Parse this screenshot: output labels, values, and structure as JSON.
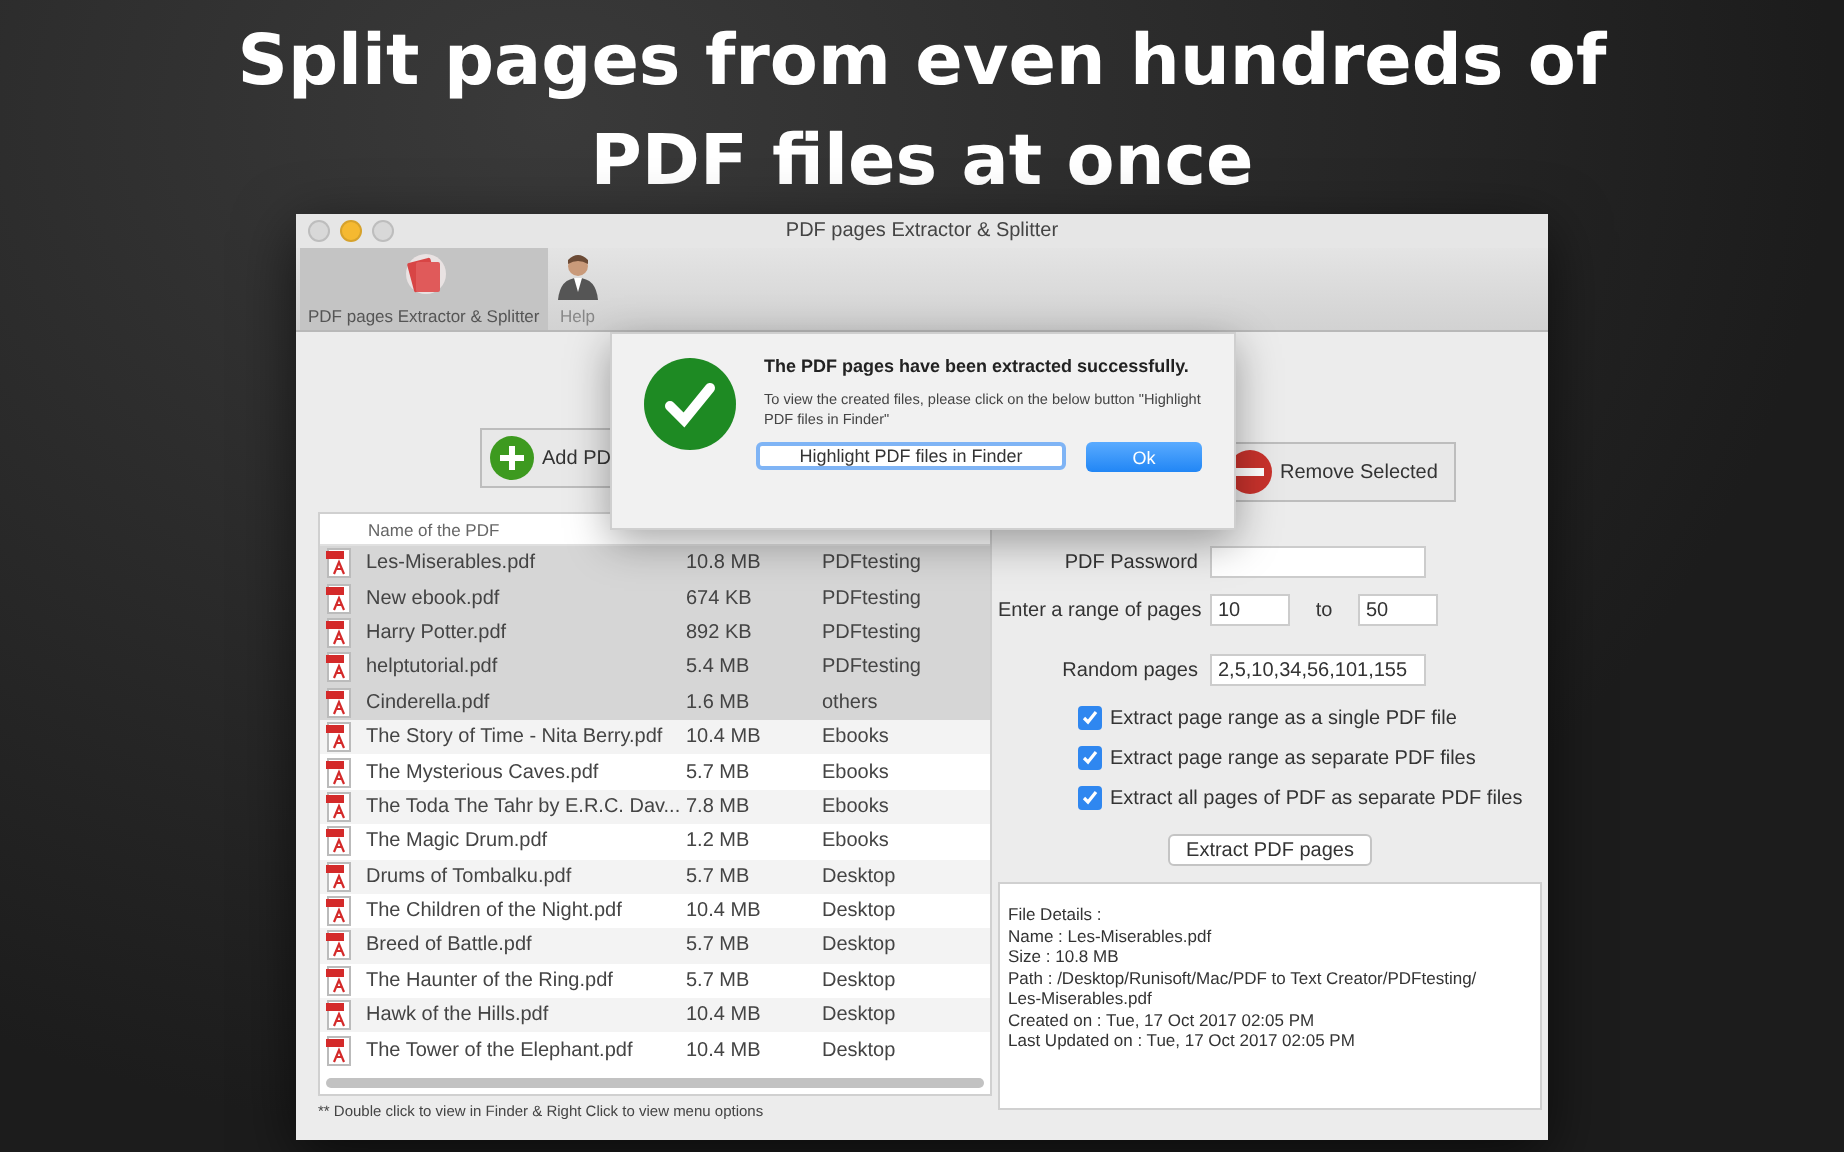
{
  "headline": "Split pages from even hundreds of PDF files at once",
  "window": {
    "title": "PDF pages Extractor & Splitter"
  },
  "toolbar": [
    {
      "label": "PDF pages Extractor & Splitter",
      "selected": true,
      "kind": "pdf"
    },
    {
      "label": "Help",
      "selected": false,
      "kind": "help"
    }
  ],
  "add_button": "Add PD",
  "remove_button": "Remove Selected",
  "table": {
    "columns": [
      "Name of the PDF"
    ],
    "rows": [
      {
        "name": "Les-Miserables.pdf",
        "size": "10.8 MB",
        "folder": "PDFtesting",
        "selected": true
      },
      {
        "name": "New ebook.pdf",
        "size": "674 KB",
        "folder": "PDFtesting",
        "selected": true
      },
      {
        "name": "Harry Potter.pdf",
        "size": "892 KB",
        "folder": "PDFtesting",
        "selected": true
      },
      {
        "name": "helptutorial.pdf",
        "size": "5.4 MB",
        "folder": "PDFtesting",
        "selected": true
      },
      {
        "name": "Cinderella.pdf",
        "size": "1.6 MB",
        "folder": "others",
        "selected": true
      },
      {
        "name": "The Story of Time - Nita Berry.pdf",
        "size": "10.4 MB",
        "folder": "Ebooks",
        "selected": false
      },
      {
        "name": "The Mysterious Caves.pdf",
        "size": "5.7 MB",
        "folder": "Ebooks",
        "selected": false
      },
      {
        "name": "The Toda The Tahr by E.R.C. Dav...",
        "size": "7.8 MB",
        "folder": "Ebooks",
        "selected": false
      },
      {
        "name": "The Magic Drum.pdf",
        "size": "1.2 MB",
        "folder": "Ebooks",
        "selected": false
      },
      {
        "name": "Drums of Tombalku.pdf",
        "size": "5.7 MB",
        "folder": "Desktop",
        "selected": false
      },
      {
        "name": "The Children of the Night.pdf",
        "size": "10.4 MB",
        "folder": "Desktop",
        "selected": false
      },
      {
        "name": "Breed of Battle.pdf",
        "size": "5.7 MB",
        "folder": "Desktop",
        "selected": false
      },
      {
        "name": "The Haunter of the Ring.pdf",
        "size": "5.7 MB",
        "folder": "Desktop",
        "selected": false
      },
      {
        "name": "Hawk of the Hills.pdf",
        "size": "10.4 MB",
        "folder": "Desktop",
        "selected": false
      },
      {
        "name": "The Tower of the Elephant.pdf",
        "size": "10.4 MB",
        "folder": "Desktop",
        "selected": false
      }
    ]
  },
  "footnote": "** Double click to view in Finder & Right Click  to view menu options",
  "form": {
    "password_label": "PDF Password",
    "range_label": "Enter a range of pages",
    "range_from": "10",
    "range_to_label": "to",
    "range_to": "50",
    "random_label": "Random pages",
    "random_value": "2,5,10,34,56,101,155"
  },
  "options": [
    {
      "label": "Extract page range as a single PDF file",
      "checked": true
    },
    {
      "label": "Extract page range as separate PDF files",
      "checked": true
    },
    {
      "label": "Extract all pages of PDF as separate PDF files",
      "checked": true
    }
  ],
  "extract_button": "Extract PDF pages",
  "details": [
    "File Details :",
    "Name : Les-Miserables.pdf",
    "Size : 10.8 MB",
    "Path :  /Desktop/Runisoft/Mac/PDF to Text Creator/PDFtesting/",
    "Les-Miserables.pdf",
    "Created on : Tue, 17 Oct 2017 02:05 PM",
    "Last Updated on : Tue, 17 Oct 2017 02:05 PM"
  ],
  "dialog": {
    "title": "The PDF pages have been extracted successfully.",
    "message": "To view the created files, please click on the below button \"Highlight PDF files in Finder\"",
    "secondary": "Highlight PDF files in Finder",
    "primary": "Ok"
  }
}
